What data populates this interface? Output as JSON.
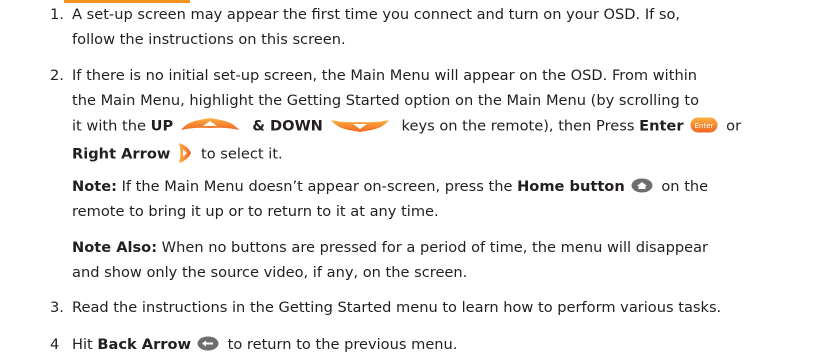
{
  "step1": {
    "number": "1.",
    "line1": "A set-up screen may appear the first time you connect and turn on your OSD.  If so,",
    "line2": "follow the instructions on this screen."
  },
  "step2": {
    "number": "2.",
    "line1": "If there is no initial set-up screen, the Main Menu will appear on the OSD.  From within",
    "line2": "the Main Menu, highlight the Getting Started option on the Main Menu (by scrolling to",
    "line3_pre": "it with the ",
    "up_label": "UP",
    "amp": " & ",
    "down_label": "DOWN",
    "line3_post": " keys on the remote), then Press ",
    "enter_label": "Enter",
    "enter_key_text": "Enter",
    "line3_or": " or",
    "right_arrow_label": "Right Arrow",
    "line4_post": " to select it."
  },
  "note1": {
    "label": "Note:",
    "text_pre": " If the Main Menu doesn’t appear on-screen, press the ",
    "home_label": "Home button",
    "text_post": " on the",
    "line2": "remote to bring it up or to return to it at any time."
  },
  "note2": {
    "label": "Note Also:",
    "text": " When no buttons are pressed for a period of time, the menu will disappear",
    "line2": "and show only the source video, if any, on the screen."
  },
  "step3": {
    "number": "3.",
    "text": "Read the instructions in the Getting Started menu to learn how to perform various tasks."
  },
  "step4": {
    "number": "4",
    "text_pre": "Hit ",
    "back_label": "Back Arrow",
    "text_post": "  to return to the previous menu."
  },
  "colors": {
    "accent": "#f7941d",
    "key_gray": "#6d6e71"
  },
  "icons": [
    "up-key-icon",
    "down-key-icon",
    "enter-key-icon",
    "right-arrow-key-icon",
    "home-key-icon",
    "back-arrow-key-icon"
  ]
}
